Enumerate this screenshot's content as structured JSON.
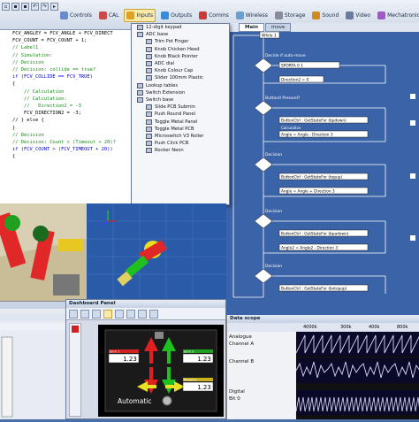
{
  "toolbar": {
    "tabs": [
      {
        "label": "Controls",
        "icon": "controls-icon",
        "color": "#6a8ac8"
      },
      {
        "label": "CAL",
        "icon": "cal-icon",
        "color": "#c84a4a"
      },
      {
        "label": "Inputs",
        "icon": "inputs-icon",
        "color": "#e0a020"
      },
      {
        "label": "Outputs",
        "icon": "outputs-icon",
        "color": "#3a8ad8"
      },
      {
        "label": "Comms",
        "icon": "comms-icon",
        "color": "#c83a3a"
      },
      {
        "label": "Wireless",
        "icon": "wireless-icon",
        "color": "#6aa0d0"
      },
      {
        "label": "Storage",
        "icon": "storage-icon",
        "color": "#8a8a9a"
      },
      {
        "label": "Sound",
        "icon": "sound-icon",
        "color": "#d08a20"
      },
      {
        "label": "Video",
        "icon": "video-icon",
        "color": "#6a7aa0"
      },
      {
        "label": "Mechatronics",
        "icon": "mechatronics-icon",
        "color": "#a05ac8"
      }
    ],
    "active_tab": "Inputs"
  },
  "code": {
    "lines": [
      {
        "t": "FCV_ANGLEY = FCV_ANGLE + FCV_DIRECT",
        "c": ""
      },
      {
        "t": "FCV_COUNT = FCV_COUNT + 1;",
        "c": ""
      },
      {
        "t": "",
        "c": ""
      },
      {
        "t": "// Label1",
        "c": "cm"
      },
      {
        "t": "// Simulation:",
        "c": "cm"
      },
      {
        "t": "",
        "c": ""
      },
      {
        "t": "// Decision",
        "c": "cm"
      },
      {
        "t": "// Decision: collide == true?",
        "c": "cm"
      },
      {
        "t": "if (FCV_COLLIDE == FCV_TRUE)",
        "c": "kw"
      },
      {
        "t": "{",
        "c": ""
      },
      {
        "t": "    // Calculation",
        "c": "cm"
      },
      {
        "t": "    // Calculation:",
        "c": "cm"
      },
      {
        "t": "    //   Direction2 = -3",
        "c": "cm"
      },
      {
        "t": "    FCV_DIRECTION2 = -3;",
        "c": ""
      },
      {
        "t": "",
        "c": ""
      },
      {
        "t": "// } else {",
        "c": ""
      },
      {
        "t": "",
        "c": ""
      },
      {
        "t": "}",
        "c": ""
      },
      {
        "t": "",
        "c": ""
      },
      {
        "t": "",
        "c": ""
      },
      {
        "t": "// Decision",
        "c": "cm"
      },
      {
        "t": "// Decision: Count > (Timeout + 20)?",
        "c": "cm"
      },
      {
        "t": "if (FCV_COUNT > (FCV_TIMEOUT + 20))",
        "c": "kw"
      },
      {
        "t": "{",
        "c": ""
      }
    ]
  },
  "menu": {
    "items": [
      {
        "label": "12-digit keypad",
        "depth": 1
      },
      {
        "label": "ADC base",
        "depth": 1
      },
      {
        "label": "Trim Pot Finger",
        "depth": 2
      },
      {
        "label": "Knob Chicken Head",
        "depth": 2
      },
      {
        "label": "Knob Black Pointer",
        "depth": 2
      },
      {
        "label": "ADC dial",
        "depth": 2
      },
      {
        "label": "Knob Colour Cap",
        "depth": 2
      },
      {
        "label": "Slider 100mm Plastic",
        "depth": 2
      },
      {
        "label": "Lookup tables",
        "depth": 1
      },
      {
        "label": "Switch Extension",
        "depth": 1
      },
      {
        "label": "Switch base",
        "depth": 1
      },
      {
        "label": "Slide PCB Submin",
        "depth": 2
      },
      {
        "label": "Push Round Panel",
        "depth": 2
      },
      {
        "label": "Toggle Metal Panel",
        "depth": 2
      },
      {
        "label": "Toggle Metal PCB",
        "depth": 2
      },
      {
        "label": "Microswitch V3 Roller",
        "depth": 2
      },
      {
        "label": "Push Click PCB",
        "depth": 2
      },
      {
        "label": "Rocker Neon",
        "depth": 2
      }
    ]
  },
  "flow": {
    "tabs": [
      "Main",
      "move"
    ],
    "active_tab": "Main",
    "nodes": {
      "while": "While 1",
      "decision1": "Decide if auto-move",
      "call1": "SPORTA 0 1",
      "calc1": "Direction2 = 0",
      "decision2": "Button0 Pressed?",
      "call2": "ButtonCtrl : GetStateFor (bpdown)",
      "calc2": "Angle = Angle - Direction 3",
      "decision3": "Decision",
      "call3": "ButtonCtrl : GetStateFor (topup)",
      "calc3": "Angle = Angle + Direction 3",
      "decision4": "Decision",
      "call4": "ButtonCtrl : GetStateFor (bpadown)",
      "calc4": "Angle2 = Angle2 - Direction 3",
      "decision5": "Decision",
      "call5": "ButtonCtrl : GetStateFor (bxtopup)",
      "calc5": "Angle2 = Angle2 + Direction 3",
      "calc_label": "Calculation"
    }
  },
  "dashboard": {
    "title": "Dashboard Panel",
    "joint1_label": "Joint 1",
    "joint1_value": "1.23",
    "joint2_label": "Joint 2",
    "joint2_value": "1.23",
    "rotation_label": "Rotation",
    "rotation_value": "1.23",
    "mode_label": "Automatic"
  },
  "scope": {
    "title": "Data scope",
    "time_labels": [
      "4000k",
      "300k",
      "400k",
      "800k"
    ],
    "group1": "Analogue",
    "ch1": "Channel A",
    "ch2": "Channel B",
    "group2": "Digital",
    "ch3": "Bit 0"
  },
  "colors": {
    "flow_bg": "#3b63a8",
    "accent": "#fbeaa7",
    "arrow_red": "#e02020",
    "arrow_green": "#20c020",
    "arrow_yellow": "#e8e020"
  }
}
